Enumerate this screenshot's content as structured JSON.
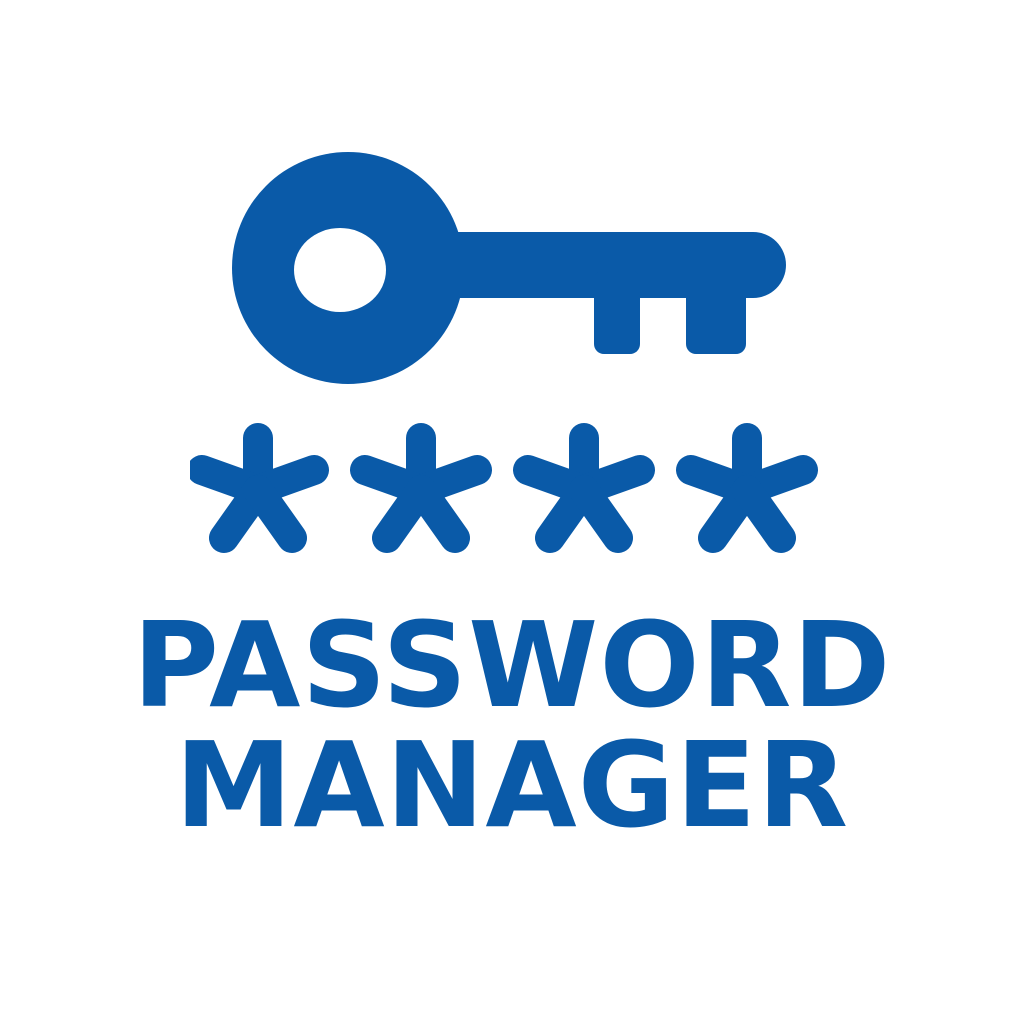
{
  "logo": {
    "title_line_1": "PASSWORD",
    "title_line_2": "MANAGER",
    "key_icon": "key-icon",
    "mask_icon": "asterisk-icon",
    "mask_count": 4
  },
  "colors": {
    "brand": "#0a5aa8",
    "background": "#ffffff"
  }
}
